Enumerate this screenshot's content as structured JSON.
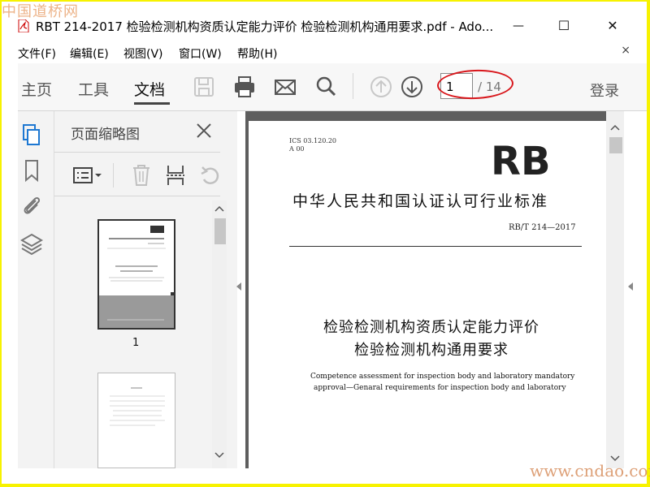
{
  "watermarks": {
    "top_left": "中国道桥网",
    "bottom_right": "www.cndao.com"
  },
  "window": {
    "title": "RBT 214-2017 检验检测机构资质认定能力评价 检验检测机构通用要求.pdf - Ado...",
    "minimize": "—",
    "maximize": "☐",
    "close": "✕"
  },
  "menu": {
    "items": [
      "文件(F)",
      "编辑(E)",
      "视图(V)",
      "窗口(W)",
      "帮助(H)"
    ],
    "close": "×"
  },
  "toolbar": {
    "tabs": [
      "主页",
      "工具",
      "文档"
    ],
    "active_tab": "文档",
    "current_page": "1",
    "total_pages": "/ 14",
    "login": "登录",
    "highlight_color": "#d8161b"
  },
  "panel": {
    "title": "页面缩略图",
    "thumbnails": [
      {
        "label": "1"
      }
    ]
  },
  "page": {
    "ics": "ICS 03.120.20",
    "ccs": "A 00",
    "logo": "RB",
    "standard_title": "中华人民共和国认证认可行业标准",
    "standard_number": "RB/T 214—2017",
    "doc_title_line1": "检验检测机构资质认定能力评价",
    "doc_title_line2": "检验检测机构通用要求",
    "english_line1": "Competence assessment for inspection body and laboratory mandatory",
    "english_line2": "approval—Genaral requirements for inspection body and laboratory"
  }
}
